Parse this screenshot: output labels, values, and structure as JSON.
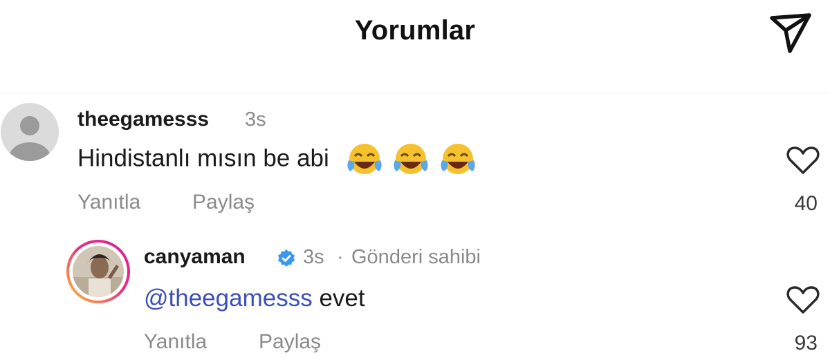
{
  "header": {
    "title": "Yorumlar",
    "send_icon": "send-paper-plane-icon"
  },
  "comments": [
    {
      "username": "theegamesss",
      "time": "3s",
      "text": "Hindistanlı mısın be abi",
      "emojis": [
        "face-with-tears-of-joy",
        "face-with-tears-of-joy",
        "face-with-tears-of-joy"
      ],
      "reply_label": "Yanıtla",
      "share_label": "Paylaş",
      "likes": "40",
      "avatar": "default-profile-icon"
    },
    {
      "username": "canyaman",
      "verified": true,
      "time": "3s",
      "separator": "·",
      "owner_label": "Gönderi sahibi",
      "mention": "@theegamesss",
      "text": "evet",
      "reply_label": "Yanıtla",
      "share_label": "Paylaş",
      "likes": "93",
      "avatar": "profile-photo-story-ring"
    }
  ],
  "colors": {
    "mention": "#3b4fb8",
    "verified": "#3897f0",
    "muted": "#8a8a8a",
    "story_ring_start": "#f9c23c",
    "story_ring_end": "#d6249f"
  }
}
